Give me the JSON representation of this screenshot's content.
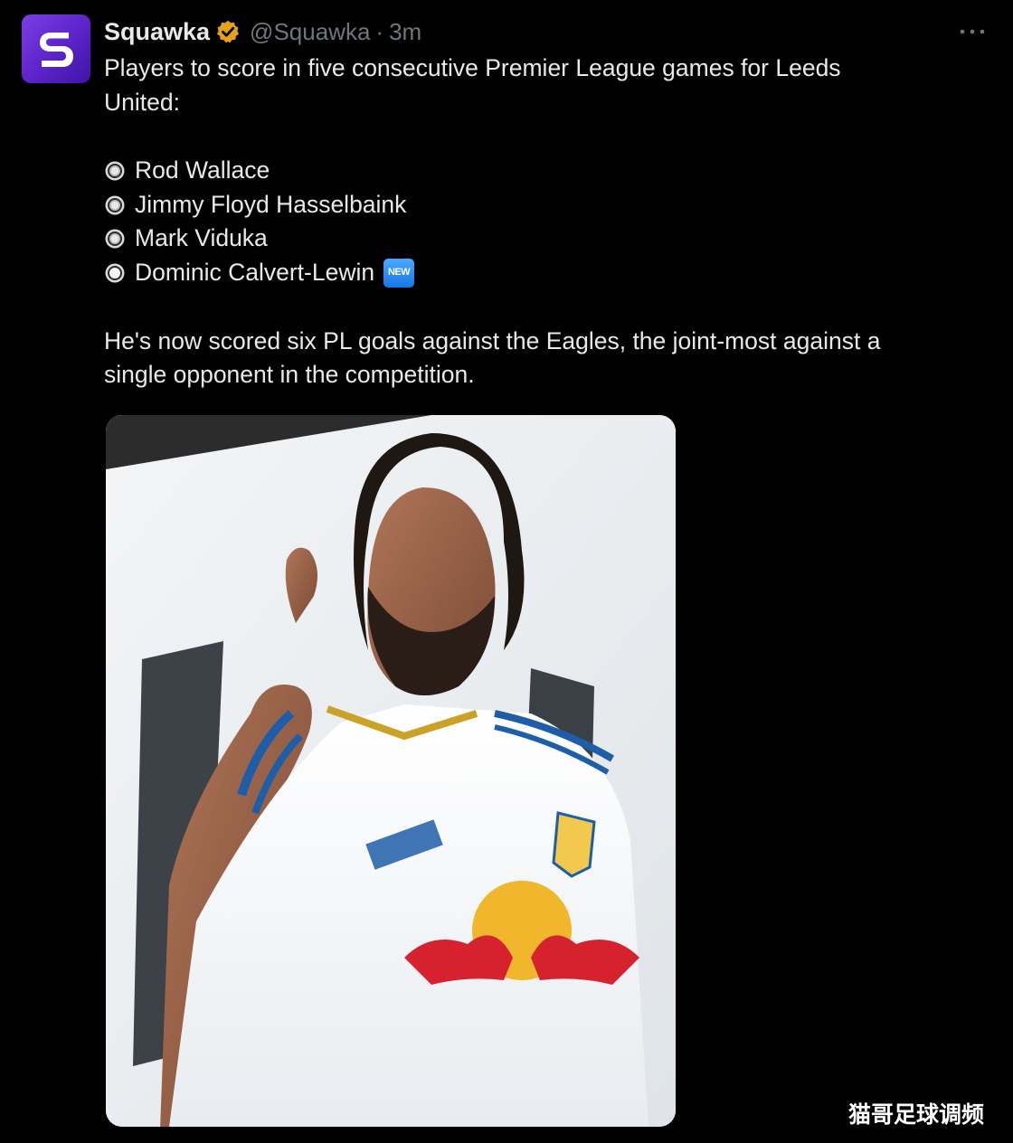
{
  "tweet": {
    "display_name": "Squawka",
    "handle": "@Squawka",
    "separator": "·",
    "time": "3m",
    "verified_icon": "verified-badge-icon",
    "more_icon": "more-options-icon",
    "text": {
      "line1": "Players to score in five consecutive Premier League games for Leeds",
      "line2": "United:",
      "list": [
        "Rod Wallace",
        "Jimmy Floyd Hasselbaink",
        "Mark Viduka",
        "Dominic Calvert-Lewin"
      ],
      "new_badge": "NEW",
      "closing_line1": "He's now scored six PL goals against the Eagles, the joint-most against a",
      "closing_line2": "single opponent in the competition."
    }
  },
  "colors": {
    "background": "#000000",
    "text": "#e7e9ea",
    "muted": "#71767b",
    "avatar": "#6a2fd8",
    "verified": "#e3a21a",
    "new_badge": "#1d86f0"
  },
  "watermark": "猫哥足球调频"
}
